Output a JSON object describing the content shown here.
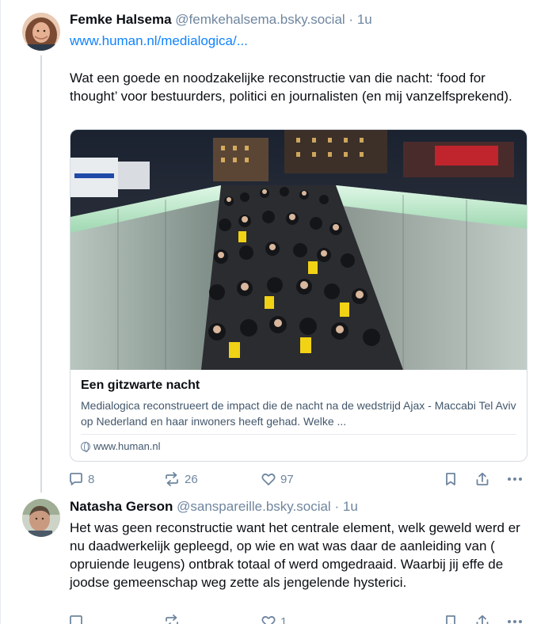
{
  "posts": [
    {
      "author": {
        "display_name": "Femke Halsema",
        "handle": "@femkehalsema.bsky.social",
        "age": "1u"
      },
      "link": "www.human.nl/medialogica/...",
      "text": "Wat een goede en noodzakelijke reconstructie van die nacht: ‘food for thought’ voor bestuurders, politici en journalisten (en mij vanzelfsprekend).",
      "card": {
        "title": "Een gitzwarte nacht",
        "description": "Medialogica reconstrueert de impact die de nacht na de wedstrijd Ajax - Maccabi Tel Aviv op Nederland en haar inwoners heeft gehad. Welke ...",
        "domain": "www.human.nl"
      },
      "actions": {
        "replies": "8",
        "reposts": "26",
        "likes": "97"
      }
    },
    {
      "author": {
        "display_name": "Natasha Gerson",
        "handle": "@sanspareille.bsky.social",
        "age": "1u"
      },
      "text": "Het was geen reconstructie want het centrale element, welk geweld werd er nu daadwerkelijk gepleegd, op wie en wat was daar de aanleiding van ( opruiende leugens) ontbrak totaal of werd omgedraaid. Waarbij jij effe de joodse gemeenschap weg zette als jengelende hysterici.",
      "actions": {
        "replies": "",
        "reposts": "",
        "likes": "1"
      }
    }
  ],
  "separator": "·",
  "colors": {
    "link": "#1083fe",
    "muted": "#6f869f",
    "border": "#d4dbe2"
  },
  "icons": [
    "reply-icon",
    "repost-icon",
    "like-icon",
    "bookmark-icon",
    "share-icon",
    "more-icon",
    "globe-icon"
  ]
}
